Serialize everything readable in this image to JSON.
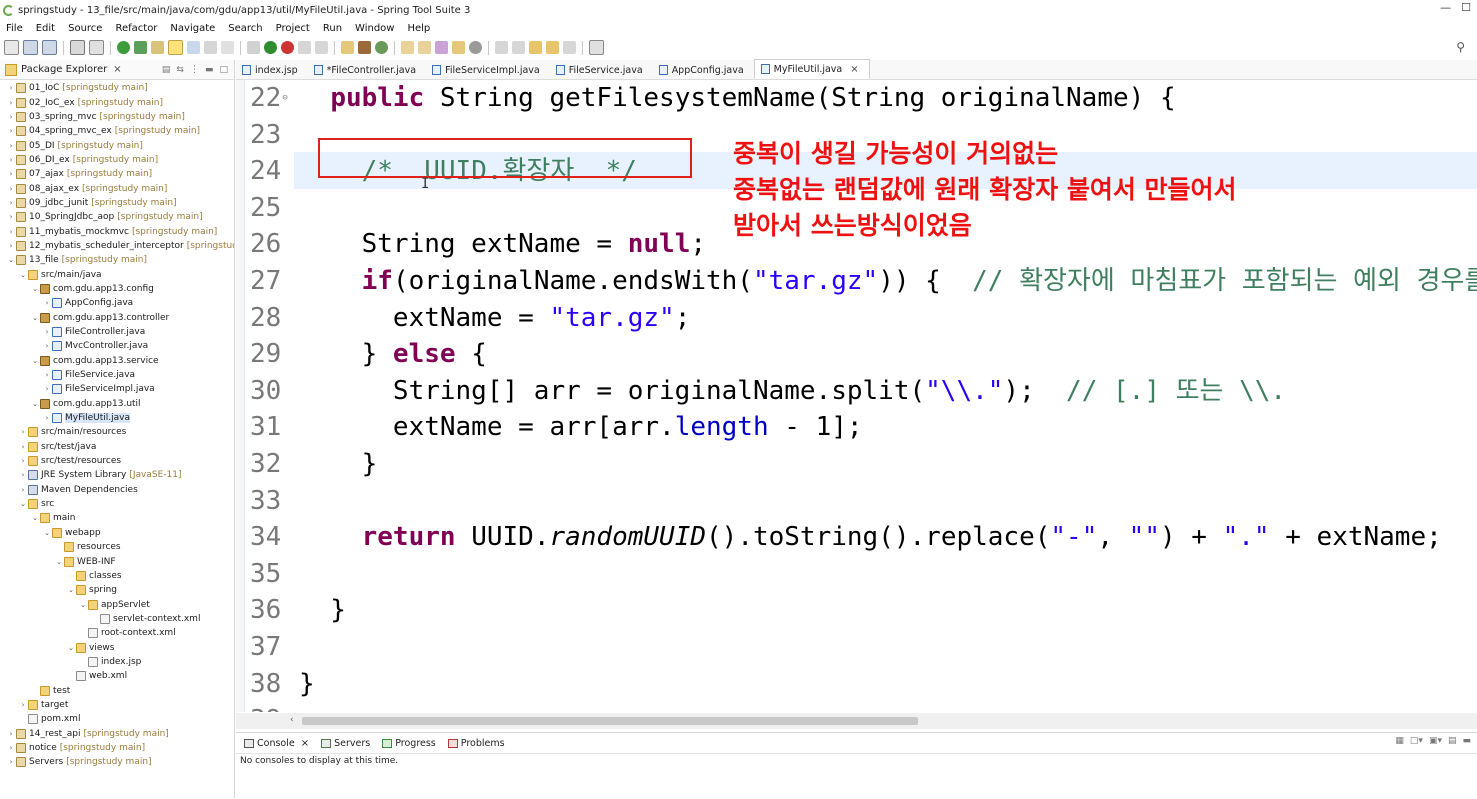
{
  "window": {
    "title": "springstudy - 13_file/src/main/java/com/gdu/app13/util/MyFileUtil.java - Spring Tool Suite 3",
    "min_label": "—",
    "max_label": "☐"
  },
  "menu": [
    "File",
    "Edit",
    "Source",
    "Refactor",
    "Navigate",
    "Search",
    "Project",
    "Run",
    "Window",
    "Help"
  ],
  "package_explorer": {
    "title": "Package Explorer",
    "close": "×",
    "tree": [
      {
        "indent": 0,
        "chev": "›",
        "icon": "project",
        "label": "01_IoC",
        "dec": "[springstudy main]"
      },
      {
        "indent": 0,
        "chev": "›",
        "icon": "project",
        "label": "02_IoC_ex",
        "dec": "[springstudy main]"
      },
      {
        "indent": 0,
        "chev": "›",
        "icon": "project",
        "label": "03_spring_mvc",
        "dec": "[springstudy main]"
      },
      {
        "indent": 0,
        "chev": "›",
        "icon": "project",
        "label": "04_spring_mvc_ex",
        "dec": "[springstudy main]"
      },
      {
        "indent": 0,
        "chev": "›",
        "icon": "project",
        "label": "05_DI",
        "dec": "[springstudy main]"
      },
      {
        "indent": 0,
        "chev": "›",
        "icon": "project",
        "label": "06_DI_ex",
        "dec": "[springstudy main]"
      },
      {
        "indent": 0,
        "chev": "›",
        "icon": "project",
        "label": "07_ajax",
        "dec": "[springstudy main]"
      },
      {
        "indent": 0,
        "chev": "›",
        "icon": "project",
        "label": "08_ajax_ex",
        "dec": "[springstudy main]"
      },
      {
        "indent": 0,
        "chev": "›",
        "icon": "project",
        "label": "09_jdbc_junit",
        "dec": "[springstudy main]"
      },
      {
        "indent": 0,
        "chev": "›",
        "icon": "project",
        "label": "10_SpringJdbc_aop",
        "dec": "[springstudy main]"
      },
      {
        "indent": 0,
        "chev": "›",
        "icon": "project",
        "label": "11_mybatis_mockmvc",
        "dec": "[springstudy main]"
      },
      {
        "indent": 0,
        "chev": "›",
        "icon": "project",
        "label": "12_mybatis_scheduler_interceptor",
        "dec": "[springstudy"
      },
      {
        "indent": 0,
        "chev": "⌄",
        "icon": "project",
        "label": "13_file",
        "dec": "[springstudy main]"
      },
      {
        "indent": 1,
        "chev": "⌄",
        "icon": "folder",
        "label": "src/main/java",
        "dec": ""
      },
      {
        "indent": 2,
        "chev": "⌄",
        "icon": "package",
        "label": "com.gdu.app13.config",
        "dec": ""
      },
      {
        "indent": 3,
        "chev": "›",
        "icon": "java",
        "label": "AppConfig.java",
        "dec": ""
      },
      {
        "indent": 2,
        "chev": "⌄",
        "icon": "package",
        "label": "com.gdu.app13.controller",
        "dec": ""
      },
      {
        "indent": 3,
        "chev": "›",
        "icon": "java",
        "label": "FileController.java",
        "dec": ""
      },
      {
        "indent": 3,
        "chev": "›",
        "icon": "java",
        "label": "MvcController.java",
        "dec": ""
      },
      {
        "indent": 2,
        "chev": "⌄",
        "icon": "package",
        "label": "com.gdu.app13.service",
        "dec": ""
      },
      {
        "indent": 3,
        "chev": "›",
        "icon": "java",
        "label": "FileService.java",
        "dec": ""
      },
      {
        "indent": 3,
        "chev": "›",
        "icon": "java",
        "label": "FileServiceImpl.java",
        "dec": ""
      },
      {
        "indent": 2,
        "chev": "⌄",
        "icon": "package",
        "label": "com.gdu.app13.util",
        "dec": ""
      },
      {
        "indent": 3,
        "chev": "›",
        "icon": "java",
        "label": "MyFileUtil.java",
        "dec": "",
        "selected": true
      },
      {
        "indent": 1,
        "chev": "›",
        "icon": "folder",
        "label": "src/main/resources",
        "dec": ""
      },
      {
        "indent": 1,
        "chev": "›",
        "icon": "folder",
        "label": "src/test/java",
        "dec": ""
      },
      {
        "indent": 1,
        "chev": "›",
        "icon": "folder",
        "label": "src/test/resources",
        "dec": ""
      },
      {
        "indent": 1,
        "chev": "›",
        "icon": "lib",
        "label": "JRE System Library",
        "dec": "[JavaSE-11]"
      },
      {
        "indent": 1,
        "chev": "›",
        "icon": "lib",
        "label": "Maven Dependencies",
        "dec": ""
      },
      {
        "indent": 1,
        "chev": "⌄",
        "icon": "folder",
        "label": "src",
        "dec": ""
      },
      {
        "indent": 2,
        "chev": "⌄",
        "icon": "folder",
        "label": "main",
        "dec": ""
      },
      {
        "indent": 3,
        "chev": "⌄",
        "icon": "folder",
        "label": "webapp",
        "dec": ""
      },
      {
        "indent": 4,
        "chev": "",
        "icon": "folder",
        "label": "resources",
        "dec": ""
      },
      {
        "indent": 4,
        "chev": "⌄",
        "icon": "folder",
        "label": "WEB-INF",
        "dec": ""
      },
      {
        "indent": 5,
        "chev": "",
        "icon": "folder",
        "label": "classes",
        "dec": ""
      },
      {
        "indent": 5,
        "chev": "⌄",
        "icon": "folder",
        "label": "spring",
        "dec": ""
      },
      {
        "indent": 6,
        "chev": "⌄",
        "icon": "folder",
        "label": "appServlet",
        "dec": ""
      },
      {
        "indent": 7,
        "chev": "",
        "icon": "file",
        "label": "servlet-context.xml",
        "dec": ""
      },
      {
        "indent": 6,
        "chev": "",
        "icon": "file",
        "label": "root-context.xml",
        "dec": ""
      },
      {
        "indent": 5,
        "chev": "⌄",
        "icon": "folder",
        "label": "views",
        "dec": ""
      },
      {
        "indent": 6,
        "chev": "",
        "icon": "file",
        "label": "index.jsp",
        "dec": ""
      },
      {
        "indent": 5,
        "chev": "",
        "icon": "file",
        "label": "web.xml",
        "dec": ""
      },
      {
        "indent": 2,
        "chev": "",
        "icon": "folder",
        "label": "test",
        "dec": ""
      },
      {
        "indent": 1,
        "chev": "›",
        "icon": "folder",
        "label": "target",
        "dec": ""
      },
      {
        "indent": 1,
        "chev": "",
        "icon": "file",
        "label": "pom.xml",
        "dec": ""
      },
      {
        "indent": 0,
        "chev": "›",
        "icon": "project",
        "label": "14_rest_api",
        "dec": "[springstudy main]"
      },
      {
        "indent": 0,
        "chev": "›",
        "icon": "project",
        "label": "notice",
        "dec": "[springstudy main]"
      },
      {
        "indent": 0,
        "chev": "›",
        "icon": "project",
        "label": "Servers",
        "dec": "[springstudy main]"
      }
    ]
  },
  "editor_tabs": [
    {
      "label": "index.jsp",
      "active": false
    },
    {
      "label": "*FileController.java",
      "active": false
    },
    {
      "label": "FileServiceImpl.java",
      "active": false
    },
    {
      "label": "FileService.java",
      "active": false
    },
    {
      "label": "AppConfig.java",
      "active": false
    },
    {
      "label": "MyFileUtil.java",
      "active": true
    }
  ],
  "editor": {
    "lines": [
      {
        "n": "22",
        "fold": "⊖",
        "code": "  [[kw:public]] String getFilesystemName(String originalName) {"
      },
      {
        "n": "23",
        "code": ""
      },
      {
        "n": "24",
        "code": "    [[cm:/*  UUID.확장자  */]]"
      },
      {
        "n": "25",
        "code": ""
      },
      {
        "n": "26",
        "code": "    String extName = [[kw:null]];"
      },
      {
        "n": "27",
        "code": "    [[kw:if]](originalName.endsWith([[str:\"tar.gz\"]])) {  [[cm:// 확장자에 마침표가 포함되는 예외 경우를 처리]]"
      },
      {
        "n": "28",
        "code": "      extName = [[str:\"tar.gz\"]];"
      },
      {
        "n": "29",
        "code": "    } [[kw:else]] {"
      },
      {
        "n": "30",
        "code": "      String[] arr = originalName.split([[str:\"\\\\.\"]]);  [[cm:// [.] 또는 \\\\.]]"
      },
      {
        "n": "31",
        "code": "      extName = arr[arr.[[fld:length]] - 1];"
      },
      {
        "n": "32",
        "code": "    }"
      },
      {
        "n": "33",
        "code": ""
      },
      {
        "n": "34",
        "code": "    [[kw:return]] UUID.[[it:randomUUID]]().toString().replace([[str:\"-\"]], [[str:\"\"]]) + [[str:\".\"]] + extName;"
      },
      {
        "n": "35",
        "code": ""
      },
      {
        "n": "36",
        "code": "  }"
      },
      {
        "n": "37",
        "code": ""
      },
      {
        "n": "38",
        "code": "}"
      },
      {
        "n": "39",
        "code": ""
      }
    ],
    "annotation": [
      "중복이 생길 가능성이 거의없는",
      "중복없는 랜덤값에 원래 확장자 붙여서 만들어서",
      "받아서 쓰는방식이었음"
    ],
    "scroll_left": "‹"
  },
  "bottom_panel": {
    "tabs": [
      {
        "label": "Console",
        "close": "×"
      },
      {
        "label": "Servers",
        "close": ""
      },
      {
        "label": "Progress",
        "close": ""
      },
      {
        "label": "Problems",
        "close": ""
      }
    ],
    "message": "No consoles to display at this time."
  },
  "colors": {
    "annotation": "#ee1111",
    "keyword": "#7f0055",
    "string": "#2a00ff",
    "comment": "#3f7f5f",
    "highlight_box": "#e0201a"
  }
}
